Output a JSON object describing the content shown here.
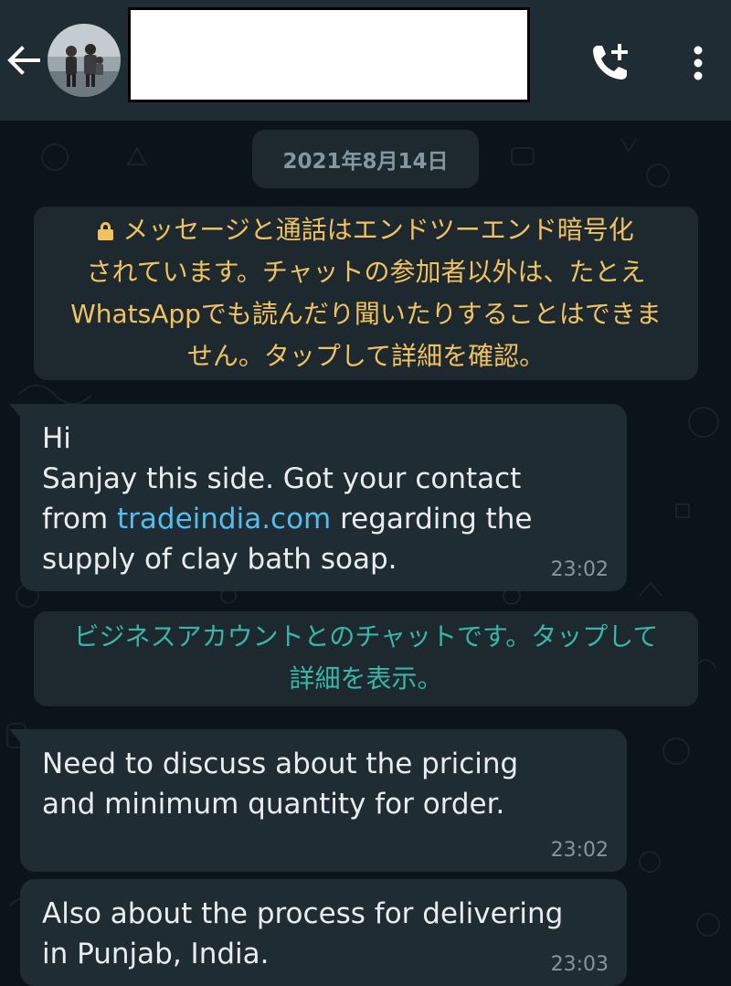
{
  "header": {
    "back_icon": "arrow-left-icon",
    "avatar": "contact-avatar",
    "contact_name": "",
    "call_icon": "add-call-icon",
    "menu_icon": "more-vert-icon"
  },
  "chat": {
    "date": "2021年8月14日",
    "encryption_notice": {
      "icon": "lock-icon",
      "lines": [
        "メッセージと通話はエンドツーエンド暗号化",
        "されています。チャットの参加者以外は、たとえ",
        "WhatsAppでも読んだり聞いたりすることはできま",
        "せん。タップして詳細を確認。"
      ]
    },
    "messages": [
      {
        "line1": "Hi",
        "line2": "Sanjay this side. Got your contact",
        "line3_before": "from ",
        "line3_link": "tradeindia.com",
        "line3_after": " regarding the",
        "line4": "supply of clay bath soap.",
        "time": "23:02"
      },
      {
        "line1": "Need to discuss about the pricing",
        "line2": "and minimum quantity for order.",
        "time": "23:02"
      },
      {
        "line1": "Also about the process for delivering",
        "line2": "in Punjab, India.",
        "time": "23:03"
      }
    ],
    "business_notice": {
      "line1": "ビジネスアカウントとのチャットです。タップして",
      "line2": "詳細を表示。"
    }
  },
  "colors": {
    "header_bg": "#1f2c34",
    "chat_bg": "#0b141a",
    "bubble_bg": "#202c33",
    "notice_text": "#f0c262",
    "business_text": "#38b7a8",
    "link": "#53bdeb",
    "timestamp": "#8696a0"
  }
}
